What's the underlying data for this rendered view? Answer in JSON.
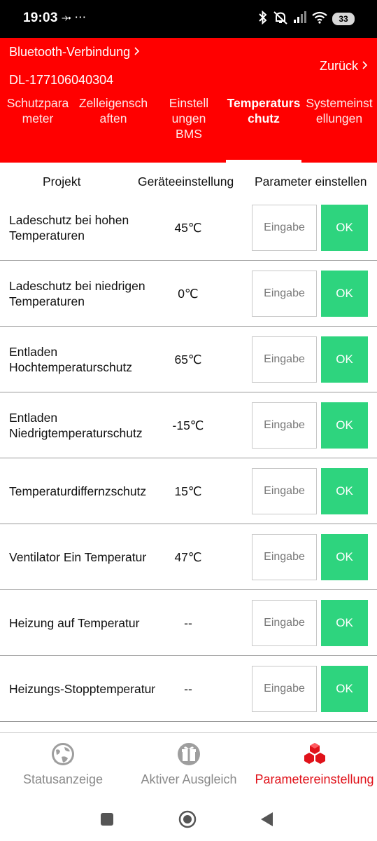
{
  "status_bar": {
    "time": "19:03",
    "left_icons": "⤞ ⋯",
    "battery": "33"
  },
  "header": {
    "bluetooth_link": "Bluetooth-Verbindung",
    "device_id": "DL-177106040304",
    "back_label": "Zurück",
    "tabs": [
      {
        "label": "Schutzpara meter"
      },
      {
        "label": "Zelleigensch aften"
      },
      {
        "label": "Einstell ungen BMS"
      },
      {
        "label": "Temperaturs chutz"
      },
      {
        "label": "Systemeinst ellungen"
      }
    ]
  },
  "table": {
    "columns": [
      "Projekt",
      "Geräteeinstellung",
      "Parameter einstellen"
    ],
    "input_placeholder": "Eingabe",
    "ok_label": "OK",
    "rows": [
      {
        "label": "Ladeschutz bei hohen Temperaturen",
        "value": "45℃"
      },
      {
        "label": "Ladeschutz bei niedrigen Temperaturen",
        "value": "0℃"
      },
      {
        "label": "Entladen Hochtemperaturschutz",
        "value": "65℃"
      },
      {
        "label": "Entladen Niedrigtemperaturschutz",
        "value": "-15℃"
      },
      {
        "label": "Temperaturdiffernzschutz",
        "value": "15℃"
      },
      {
        "label": "Ventilator Ein Temperatur",
        "value": "47℃"
      },
      {
        "label": "Heizung auf Temperatur",
        "value": "--"
      },
      {
        "label": "Heizungs-Stopptemperatur",
        "value": "--"
      }
    ]
  },
  "bottom_nav": {
    "items": [
      {
        "label": "Statusanzeige",
        "icon": "globe-icon"
      },
      {
        "label": "Aktiver Ausgleich",
        "icon": "gift-icon"
      },
      {
        "label": "Parametereinstellung",
        "icon": "cubes-icon"
      }
    ],
    "active_color": "#e0121a"
  },
  "colors": {
    "header_red": "#ff0000",
    "ok_green": "#2ed47e"
  }
}
